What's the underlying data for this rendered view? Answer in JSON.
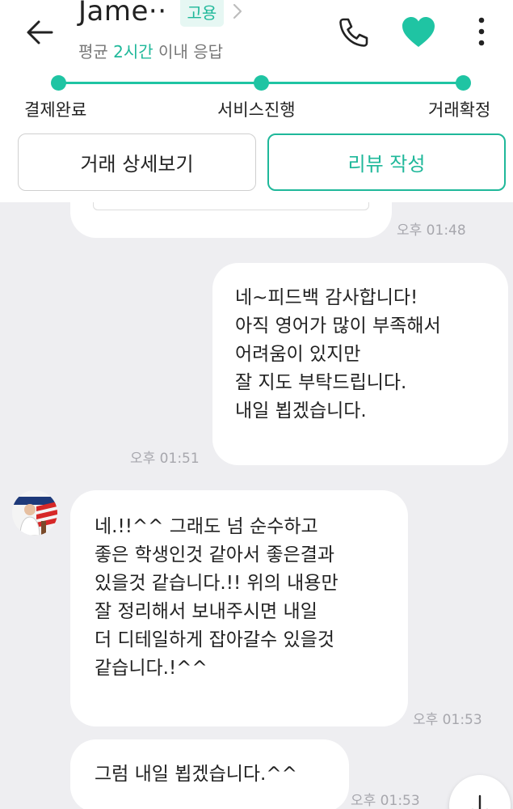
{
  "header": {
    "name": "Jame··",
    "hire_badge": "고용",
    "response_prefix": "평균 ",
    "response_time": "2시간",
    "response_suffix": " 이내 응답",
    "icons": {
      "back": "back-arrow-icon",
      "profile": "chevron-right-icon",
      "call": "phone-icon",
      "favorite": "heart-icon",
      "more": "more-vertical-icon"
    },
    "accent_color": "#1fc4a3"
  },
  "progress": {
    "steps": [
      "결제완료",
      "서비스진행",
      "거래확정"
    ]
  },
  "actions": {
    "detail_label": "거래 상세보기",
    "review_label": "리뷰 작성"
  },
  "chat": {
    "messages": [
      {
        "side": "left",
        "time": "오후 01:48",
        "lines": []
      },
      {
        "side": "right",
        "time": "오후 01:51",
        "lines": [
          "네~피드백 감사합니다!",
          "아직 영어가 많이 부족해서",
          "어려움이 있지만",
          "잘 지도 부탁드립니다.",
          "내일 뵙겠습니다."
        ]
      },
      {
        "side": "left",
        "time": "오후 01:53",
        "lines": [
          "네.!!^^ 그래도 넘 순수하고",
          "좋은 학생인것 같아서 좋은결과",
          "있을것 같습니다.!! 위의 내용만",
          "잘 정리해서 보내주시면 내일",
          "더 디테일하게 잡아갈수 있을것",
          "같습니다.!^^"
        ]
      },
      {
        "side": "left",
        "time": "오후 01:53",
        "lines": [
          "그럼 내일 뵙겠습니다.^^"
        ]
      }
    ],
    "icons": {
      "scroll_down": "arrow-down-icon",
      "avatar": "avatar"
    }
  }
}
